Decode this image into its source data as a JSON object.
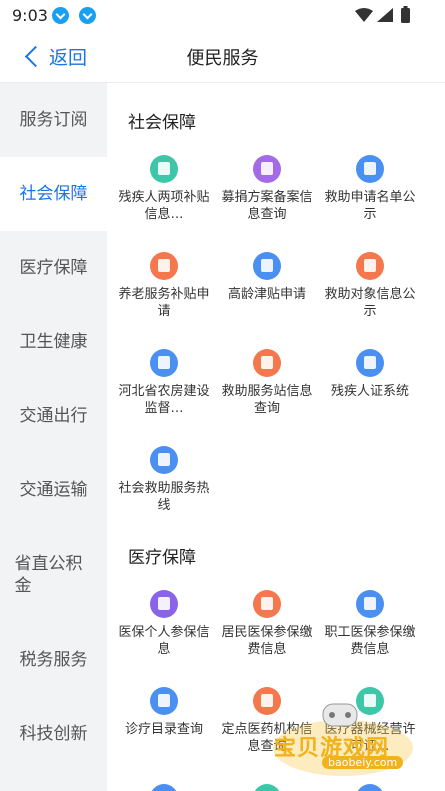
{
  "status_bar": {
    "time": "9:03"
  },
  "header": {
    "back_label": "返回",
    "title": "便民服务"
  },
  "sidebar": {
    "items": [
      {
        "label": "服务订阅",
        "active": false
      },
      {
        "label": "社会保障",
        "active": true
      },
      {
        "label": "医疗保障",
        "active": false
      },
      {
        "label": "卫生健康",
        "active": false
      },
      {
        "label": "交通出行",
        "active": false
      },
      {
        "label": "交通运输",
        "active": false
      },
      {
        "label": "省直公积金",
        "active": false
      },
      {
        "label": "税务服务",
        "active": false
      },
      {
        "label": "科技创新",
        "active": false
      }
    ]
  },
  "sections": [
    {
      "title": "社会保障",
      "services": [
        {
          "label": "残疾人两项补贴信息…",
          "icon": "handicap-subsidy-icon",
          "color": "#3ec6a8"
        },
        {
          "label": "募捐方案备案信息查询",
          "icon": "donation-badge-icon",
          "color": "#a46be8"
        },
        {
          "label": "救助申请名单公示",
          "icon": "aid-hand-icon",
          "color": "#4a8ff2"
        },
        {
          "label": "养老服务补贴申请",
          "icon": "pension-subsidy-icon",
          "color": "#f4774e"
        },
        {
          "label": "高龄津贴申请",
          "icon": "senior-allowance-icon",
          "color": "#4a8ff2"
        },
        {
          "label": "救助对象信息公示",
          "icon": "heart-hand-icon",
          "color": "#f4774e"
        },
        {
          "label": "河北省农房建设监督…",
          "icon": "building-icon",
          "color": "#4a8ff2"
        },
        {
          "label": "救助服务站信息查询",
          "icon": "house-icon",
          "color": "#f4774e"
        },
        {
          "label": "残疾人证系统",
          "icon": "id-card-icon",
          "color": "#4a8ff2"
        },
        {
          "label": "社会救助服务热线",
          "icon": "helpline-icon",
          "color": "#4a8ff2"
        }
      ]
    },
    {
      "title": "医疗保障",
      "services": [
        {
          "label": "医保个人参保信息",
          "icon": "medical-card-icon",
          "color": "#8a63e8"
        },
        {
          "label": "居民医保参保缴费信息",
          "icon": "resident-insurance-icon",
          "color": "#f4774e"
        },
        {
          "label": "职工医保参保缴费信息",
          "icon": "employee-insurance-icon",
          "color": "#4a8ff2"
        },
        {
          "label": "诊疗目录查询",
          "icon": "catalog-icon",
          "color": "#4a8ff2"
        },
        {
          "label": "定点医药机构信息查询",
          "icon": "hospital-icon",
          "color": "#f4774e"
        },
        {
          "label": "医疗器械经营许可证…",
          "icon": "device-license-icon",
          "color": "#3ec6a8"
        }
      ]
    }
  ],
  "watermark": {
    "text": "宝贝游戏网",
    "url": "baobeiy.com"
  }
}
